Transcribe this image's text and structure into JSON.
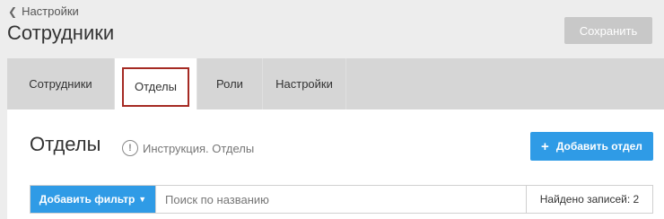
{
  "header": {
    "back_label": "Настройки",
    "title": "Сотрудники",
    "save_label": "Сохранить"
  },
  "tabs": [
    {
      "label": "Сотрудники"
    },
    {
      "label": "Отделы"
    },
    {
      "label": "Роли"
    },
    {
      "label": "Настройки"
    }
  ],
  "section": {
    "title": "Отделы",
    "help_label": "Инструкция. Отделы",
    "add_button_label": "Добавить отдел"
  },
  "filter": {
    "add_filter_label": "Добавить фильтр",
    "search_placeholder": "Поиск по названию",
    "records_found": "Найдено записей: 2"
  },
  "colors": {
    "accent": "#2f9be6",
    "active_tab_outline": "#a52a23",
    "disabled_button": "#c8c8c8"
  }
}
